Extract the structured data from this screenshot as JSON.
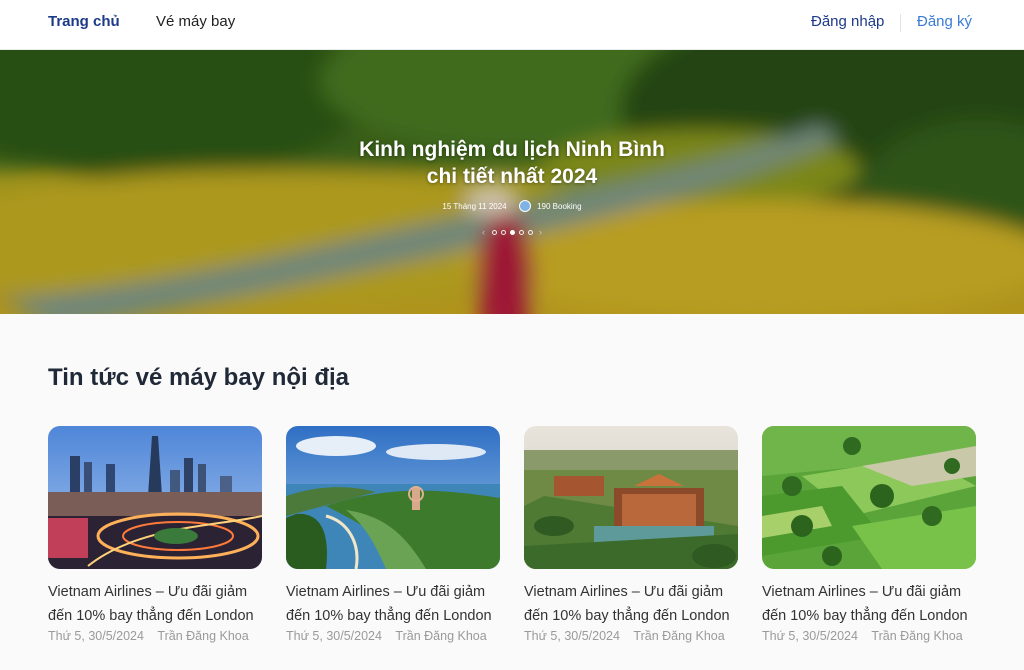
{
  "nav": {
    "home": "Trang chủ",
    "flights": "Vé máy bay",
    "login": "Đăng nhập",
    "register": "Đăng ký"
  },
  "hero": {
    "title_line1": "Kinh nghiệm du lịch Ninh Bình",
    "title_line2": "chi tiết nhất 2024",
    "date": "15 Tháng 11 2024",
    "author": "190 Booking",
    "slide_count": 5,
    "active_slide": 3
  },
  "section": {
    "title": "Tin tức vé máy bay nội địa"
  },
  "cards": [
    {
      "title_line1": "Vietnam Airlines – Ưu đãi giảm",
      "title_line2": "đến 10% bay thẳng đến London",
      "date": "Thứ 5, 30/5/2024",
      "author": "Trần Đăng Khoa"
    },
    {
      "title_line1": "Vietnam Airlines – Ưu đãi giảm",
      "title_line2": "đến 10% bay thẳng đến London",
      "date": "Thứ 5, 30/5/2024",
      "author": "Trần Đăng Khoa"
    },
    {
      "title_line1": "Vietnam Airlines – Ưu đãi giảm",
      "title_line2": "đến 10% bay thẳng đến London",
      "date": "Thứ 5, 30/5/2024",
      "author": "Trần Đăng Khoa"
    },
    {
      "title_line1": "Vietnam Airlines – Ưu đãi giảm",
      "title_line2": "đến 10% bay thẳng đến London",
      "date": "Thứ 5, 30/5/2024",
      "author": "Trần Đăng Khoa"
    }
  ],
  "colors": {
    "brand_dark": "#1d3a8a",
    "brand_light": "#3a7bd5",
    "meta_gray": "#9a9a9a"
  }
}
